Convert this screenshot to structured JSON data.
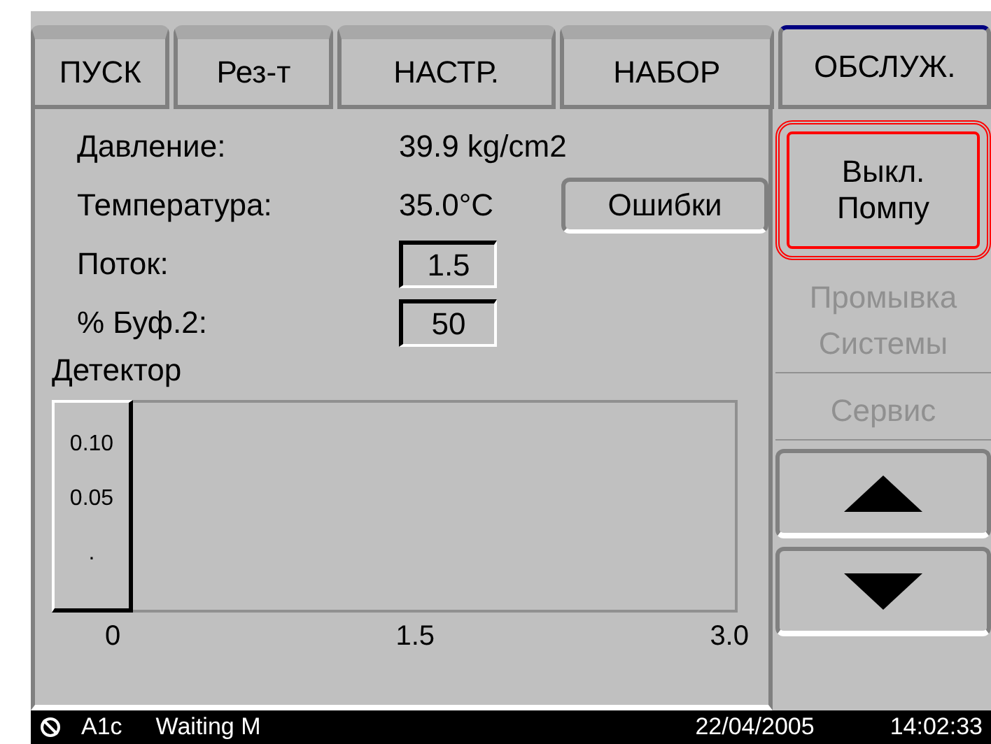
{
  "tabs": [
    {
      "label": "ПУСК",
      "selected": false
    },
    {
      "label": "Рез-т",
      "selected": false
    },
    {
      "label": "НАСТР.",
      "selected": false
    },
    {
      "label": "НАБОР",
      "selected": false
    },
    {
      "label": "ОБСЛУЖ.",
      "selected": true
    }
  ],
  "readings": [
    {
      "kind": "text",
      "label": "Давление:",
      "value": "39.9 kg/cm2"
    },
    {
      "kind": "text",
      "label": "Температура:",
      "value": "35.0°C"
    },
    {
      "kind": "field",
      "label": "Поток:",
      "value": "1.5"
    },
    {
      "kind": "field",
      "label": "% Буф.2:",
      "value": "50"
    }
  ],
  "errors_button": {
    "label": "Ошибки"
  },
  "detector": {
    "title": "Детектор",
    "y_labels": [
      "0.10",
      "0.05",
      "."
    ],
    "x_labels": [
      "0",
      "1.5",
      "3.0"
    ]
  },
  "side_buttons": [
    {
      "kind": "button",
      "label": "Выкл.\nПомпу",
      "disabled": false,
      "highlighted": true
    },
    {
      "kind": "plain",
      "label": "Промывка\nСистемы",
      "disabled": true,
      "highlighted": false
    },
    {
      "kind": "plain",
      "label": "Сервис",
      "disabled": true,
      "highlighted": false
    },
    {
      "kind": "up",
      "disabled": false,
      "highlighted": false
    },
    {
      "kind": "down",
      "disabled": false,
      "highlighted": false
    }
  ],
  "status_bar": {
    "device": "A1c",
    "state": "Waiting M",
    "date": "22/04/2005",
    "time": "14:02:33"
  }
}
